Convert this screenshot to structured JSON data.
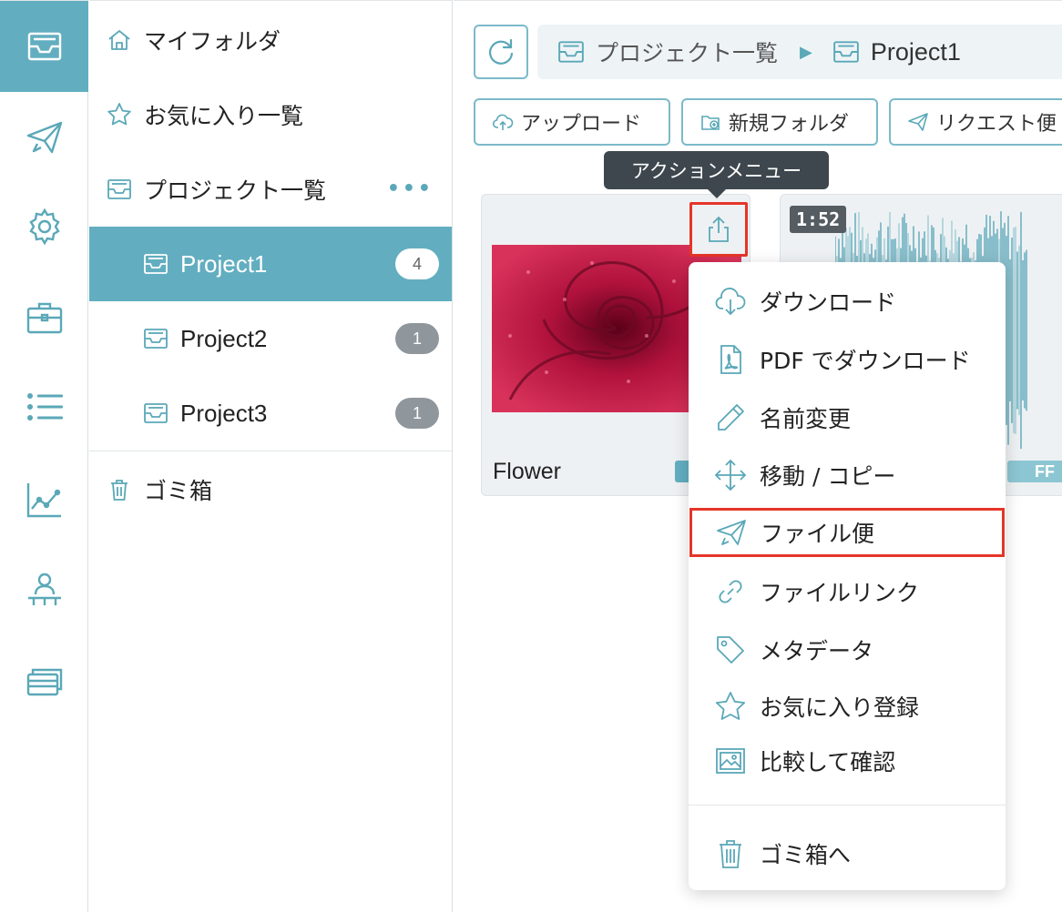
{
  "panel": {
    "nav": [
      {
        "label": "マイフォルダ",
        "icon": "home-icon"
      },
      {
        "label": "お気に入り一覧",
        "icon": "star-icon"
      },
      {
        "label": "プロジェクト一覧",
        "icon": "inbox-folder-icon",
        "more": "•••"
      }
    ],
    "projects": [
      {
        "label": "Project1",
        "count": "4",
        "selected": true
      },
      {
        "label": "Project2",
        "count": "1"
      },
      {
        "label": "Project3",
        "count": "1"
      }
    ],
    "trash": {
      "label": "ゴミ箱",
      "icon": "trash-icon"
    }
  },
  "rail": {
    "items": [
      "inbox-icon",
      "send-icon",
      "gear-icon",
      "briefcase-icon",
      "list-icon",
      "chart-icon",
      "org-icon",
      "cards-icon"
    ]
  },
  "breadcrumb": {
    "root": "プロジェクト一覧",
    "current": "Project1"
  },
  "toolbar": {
    "upload": "アップロード",
    "new_folder": "新規フォルダ",
    "request": "リクエスト便"
  },
  "tooltip": "アクションメニュー",
  "cards": [
    {
      "title": "Flower"
    },
    {
      "duration": "1:52",
      "tag": "FF"
    }
  ],
  "menu": {
    "items": [
      {
        "label": "ダウンロード",
        "icon": "cloud-download-icon"
      },
      {
        "label": "PDF でダウンロード",
        "icon": "pdf-file-icon"
      },
      {
        "label": "名前変更",
        "icon": "pencil-icon"
      },
      {
        "label": "移動 / コピー",
        "icon": "move-icon"
      },
      {
        "label": "ファイル便",
        "icon": "send-icon"
      },
      {
        "label": "ファイルリンク",
        "icon": "link-icon"
      },
      {
        "label": "メタデータ",
        "icon": "tag-icon"
      },
      {
        "label": "お気に入り登録",
        "icon": "star-icon"
      },
      {
        "label": "比較して確認",
        "icon": "image-compare-icon"
      }
    ],
    "trash": {
      "label": "ゴミ箱へ",
      "icon": "trash-icon"
    }
  },
  "colors": {
    "accent": "#62aec0",
    "highlight": "#e53528",
    "badge": "#8f969c"
  }
}
